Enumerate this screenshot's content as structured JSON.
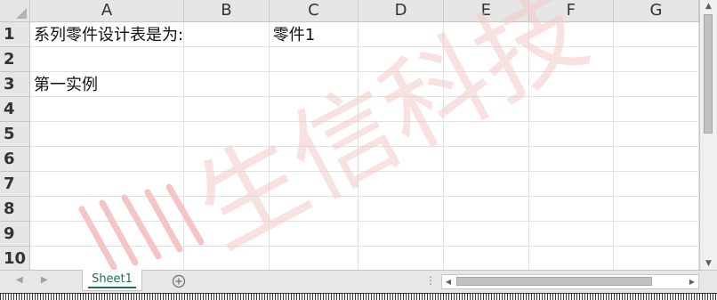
{
  "columns": [
    "A",
    "B",
    "C",
    "D",
    "E",
    "F",
    "G"
  ],
  "rows": [
    {
      "num": "1",
      "cells": {
        "A": "系列零件设计表是为:",
        "C": "零件1"
      }
    },
    {
      "num": "2",
      "cells": {}
    },
    {
      "num": "3",
      "cells": {
        "A": "第一实例"
      }
    },
    {
      "num": "4",
      "cells": {}
    },
    {
      "num": "5",
      "cells": {}
    },
    {
      "num": "6",
      "cells": {}
    },
    {
      "num": "7",
      "cells": {}
    },
    {
      "num": "8",
      "cells": {}
    },
    {
      "num": "9",
      "cells": {}
    },
    {
      "num": "10",
      "cells": {}
    }
  ],
  "sheet_tabs": [
    "Sheet1"
  ],
  "add_sheet_icon": "plus-circle-icon",
  "watermark": {
    "text": "生信科技",
    "color": "#f3c9c9"
  },
  "colors": {
    "tab_accent": "#217346",
    "header_bg": "#e6e6e6",
    "gridline": "#e1e1e1"
  }
}
